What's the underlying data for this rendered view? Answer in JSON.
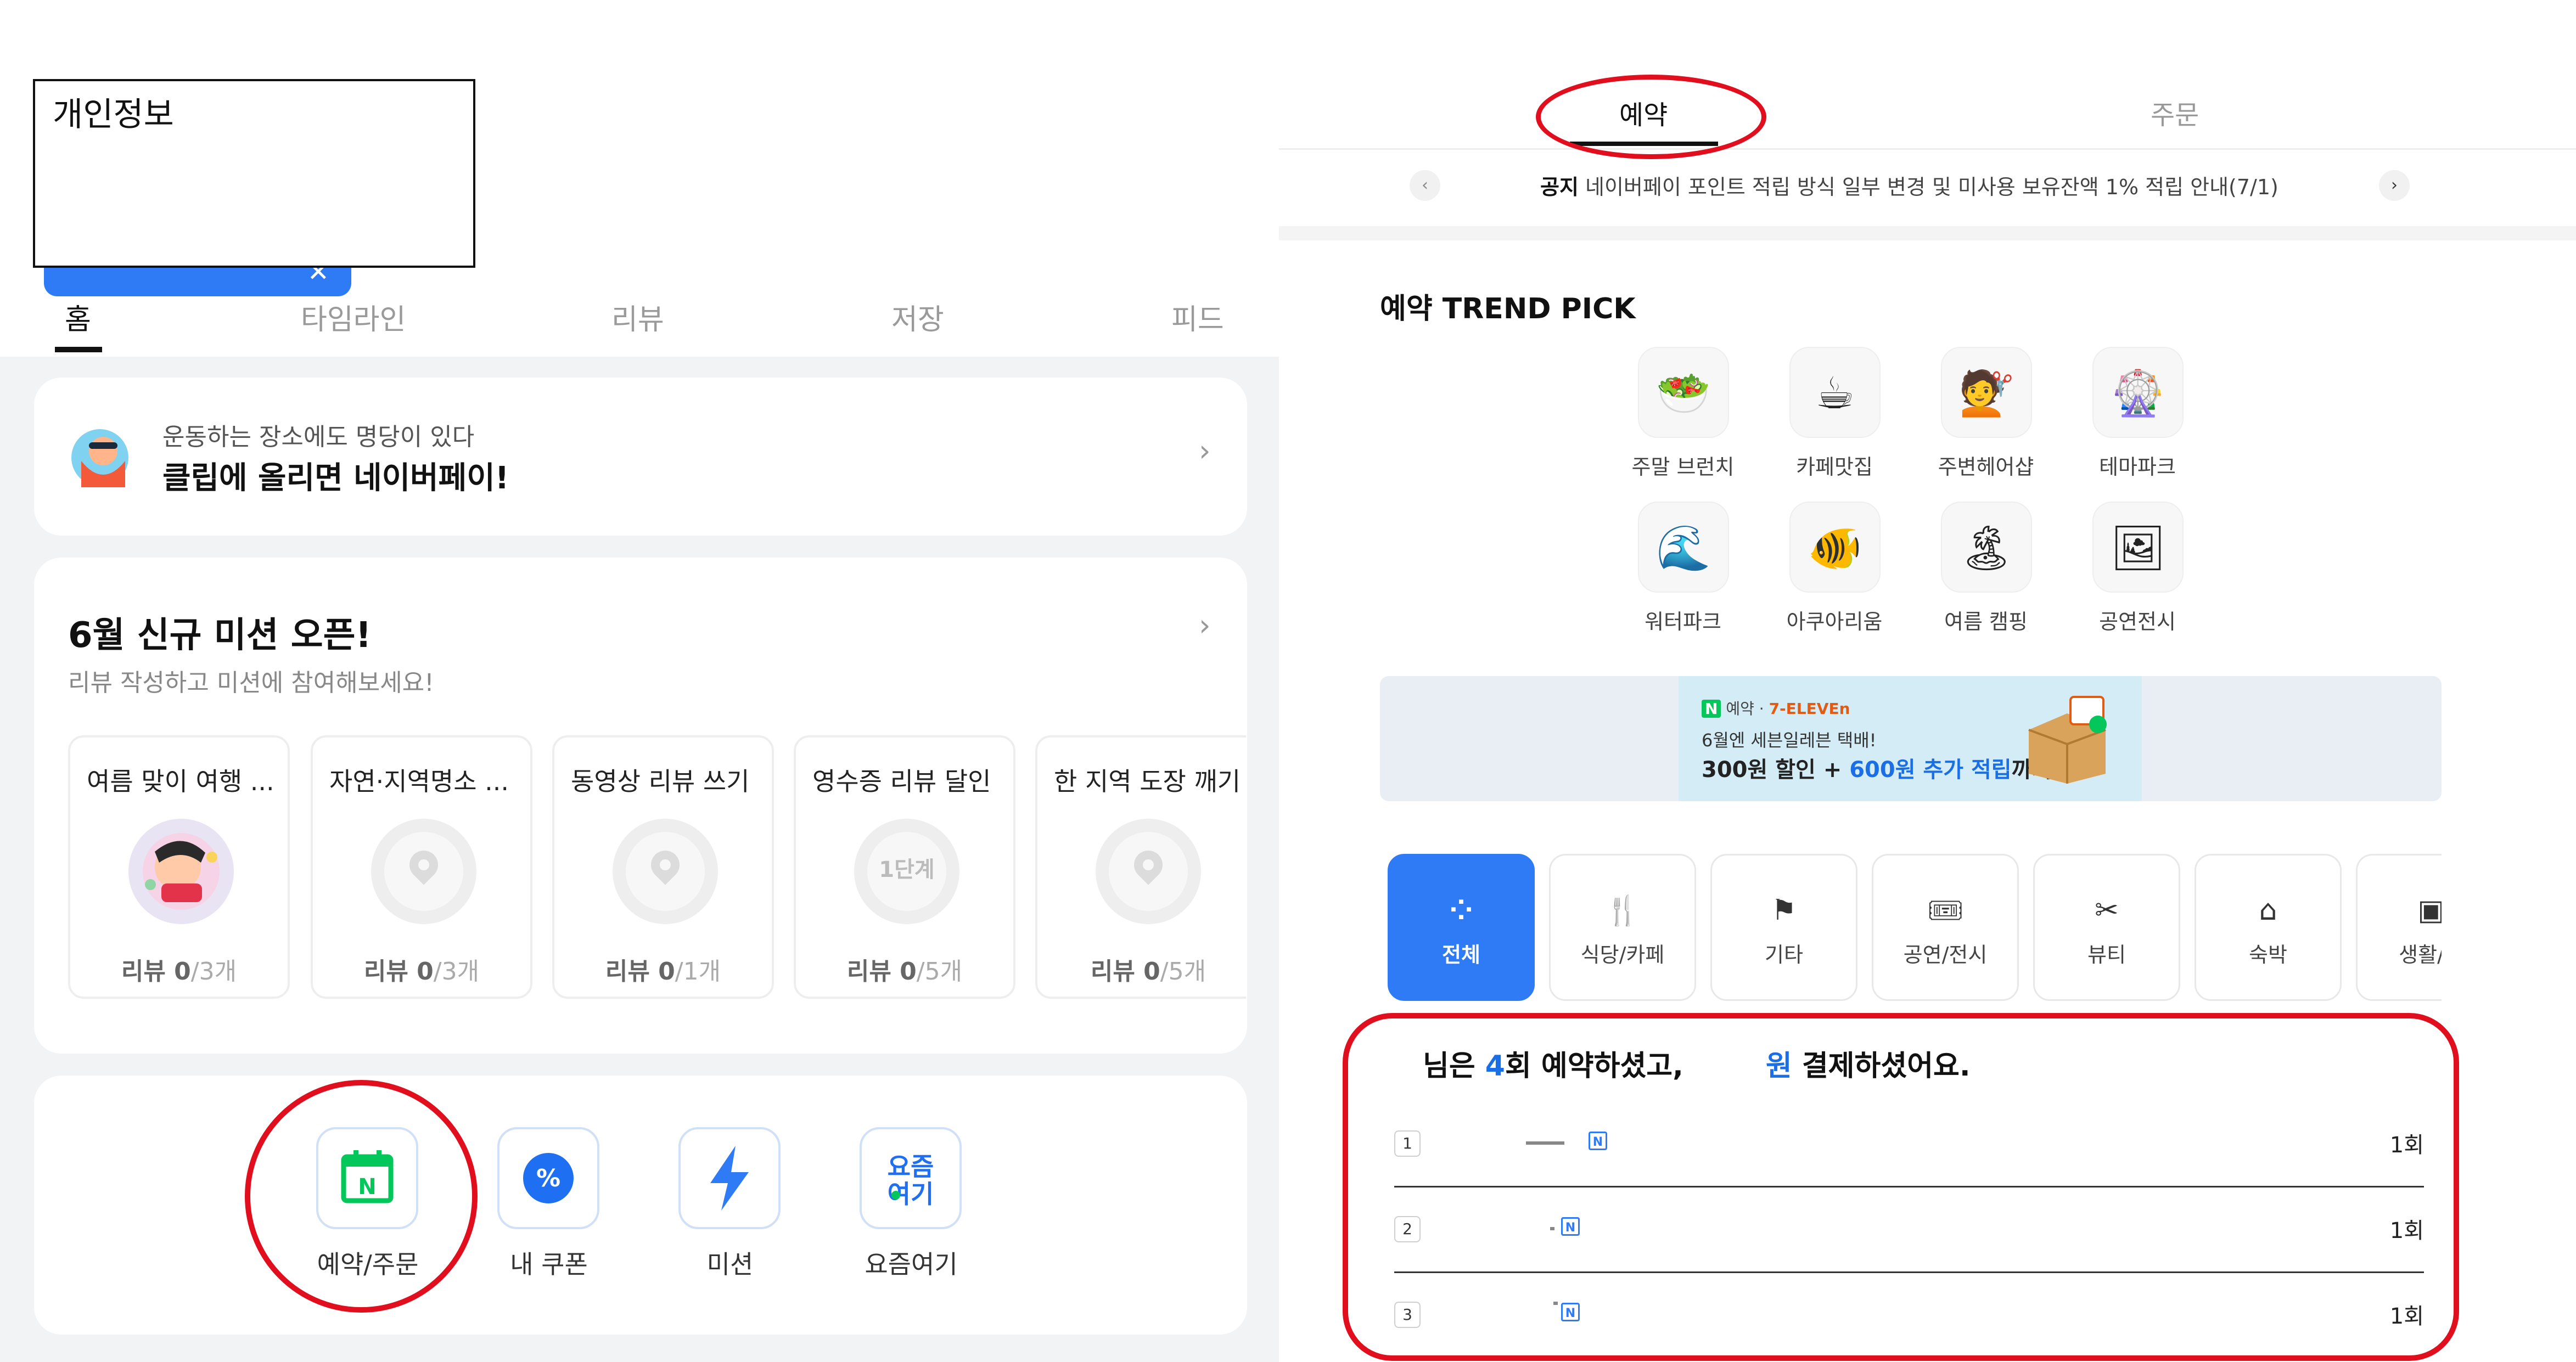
{
  "left": {
    "privacy_label": "개인정보",
    "hidden_pill_close": "✕",
    "tabs": [
      "홈",
      "타임라인",
      "리뷰",
      "저장",
      "피드"
    ],
    "banner": {
      "subtitle": "운동하는 장소에도 명당이 있다",
      "title": "클립에 올리면 네이버페이!",
      "chevron": "›"
    },
    "mission": {
      "title": "6월 신규 미션 오픈!",
      "subtitle": "리뷰 작성하고 미션에 참여해보세요!",
      "chevron": "›",
      "cards": [
        {
          "title": "여름 맞이 여행 ...",
          "done": "리뷰 0",
          "total": "/3개"
        },
        {
          "title": "자연·지역명소 ...",
          "done": "리뷰 0",
          "total": "/3개"
        },
        {
          "title": "동영상 리뷰 쓰기",
          "done": "리뷰 0",
          "total": "/1개"
        },
        {
          "title": "영수증 리뷰 달인",
          "done": "리뷰 0",
          "total": "/5개",
          "step": "1단계"
        },
        {
          "title": "한 지역 도장 깨기",
          "done": "리뷰 0",
          "total": "/5개"
        }
      ]
    },
    "shortcuts": [
      {
        "label": "예약/주문",
        "icon": "calendar-n-icon",
        "glyph": "N"
      },
      {
        "label": "내 쿠폰",
        "icon": "coupon-icon",
        "glyph": "%"
      },
      {
        "label": "미션",
        "icon": "lightning-icon",
        "glyph": "⚡"
      },
      {
        "label": "요즘여기",
        "icon": "yojeum-yeogi-icon",
        "glyph": "요즘\n여기"
      }
    ]
  },
  "right": {
    "tabs": [
      "예약",
      "주문"
    ],
    "notice": {
      "tag": "공지",
      "text": "네이버페이 포인트 적립 방식 일부 변경 및 미사용 보유잔액 1% 적립 안내(7/1)",
      "prev": "‹",
      "next": "›"
    },
    "trend": {
      "title": "예약 TREND PICK",
      "items": [
        {
          "label": "주말 브런치",
          "emoji": "🥗"
        },
        {
          "label": "카페맛집",
          "emoji": "☕"
        },
        {
          "label": "주변헤어샵",
          "emoji": "💇"
        },
        {
          "label": "테마파크",
          "emoji": "🎡"
        },
        {
          "label": "워터파크",
          "emoji": "🌊"
        },
        {
          "label": "아쿠아리움",
          "emoji": "🐠"
        },
        {
          "label": "여름 캠핑",
          "emoji": "🏝"
        },
        {
          "label": "공연전시",
          "emoji": "🖼"
        }
      ]
    },
    "ad": {
      "brand_a": "예약",
      "brand_b": "7-ELEVEn",
      "line1": "6월엔 세븐일레븐 택배!",
      "line2_a": "300원 할인 + ",
      "line2_b": "600원 추가 적립",
      "line2_c": "까지"
    },
    "categories": [
      {
        "label": "전체",
        "glyph": "⁘"
      },
      {
        "label": "식당/카페",
        "glyph": "🍴"
      },
      {
        "label": "기타",
        "glyph": "⚑"
      },
      {
        "label": "공연/전시",
        "glyph": "🎟"
      },
      {
        "label": "뷰티",
        "glyph": "✂"
      },
      {
        "label": "숙박",
        "glyph": "⌂"
      },
      {
        "label": "생활/물",
        "glyph": "▣"
      }
    ],
    "summary": {
      "part1": "님은 ",
      "count": "4",
      "part2": "회 예약하셨고,",
      "won": "원",
      "part3": " 결제하셨어요."
    },
    "ranking": [
      {
        "rank": "1",
        "count": "1회",
        "badge": "N"
      },
      {
        "rank": "2",
        "count": "1회",
        "badge": "N"
      },
      {
        "rank": "3",
        "count": "1회",
        "badge": "N"
      }
    ]
  },
  "colors": {
    "accent": "#2f7bf6",
    "highlight_red": "#e10e1e",
    "naver_green": "#03c75a"
  }
}
